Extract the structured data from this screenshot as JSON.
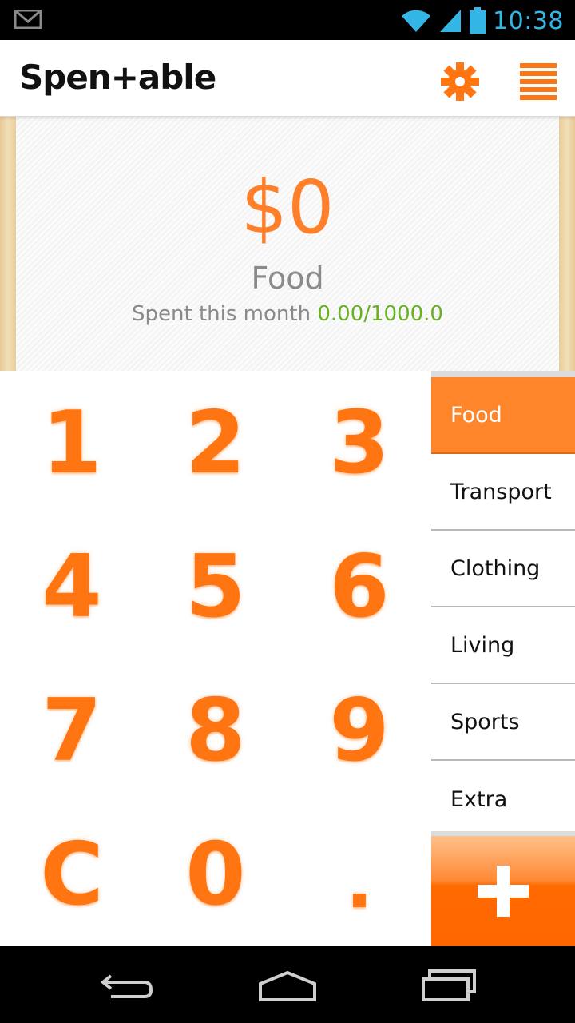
{
  "status_bar": {
    "time": "10:38",
    "icons": [
      "gmail-icon",
      "wifi-icon",
      "signal-icon",
      "battery-icon"
    ]
  },
  "app_bar": {
    "logo": "Spen+able",
    "icons": [
      "settings-icon",
      "menu-icon"
    ],
    "accent_color": "#ff7f2a"
  },
  "summary": {
    "amount": "$0",
    "category": "Food",
    "spent_label": "Spent this month",
    "spent_value": "0.00/1000.0",
    "spent_value_color": "#6ab023"
  },
  "keypad": {
    "keys": [
      "1",
      "2",
      "3",
      "4",
      "5",
      "6",
      "7",
      "8",
      "9",
      "C",
      "0",
      "."
    ]
  },
  "categories": {
    "selected": "Food",
    "items": [
      "Food",
      "Transport",
      "Clothing",
      "Living",
      "Sports",
      "Extra"
    ]
  },
  "add_button": {
    "icon": "plus-icon"
  },
  "nav_bar": {
    "icons": [
      "back-icon",
      "home-icon",
      "recent-apps-icon"
    ]
  }
}
